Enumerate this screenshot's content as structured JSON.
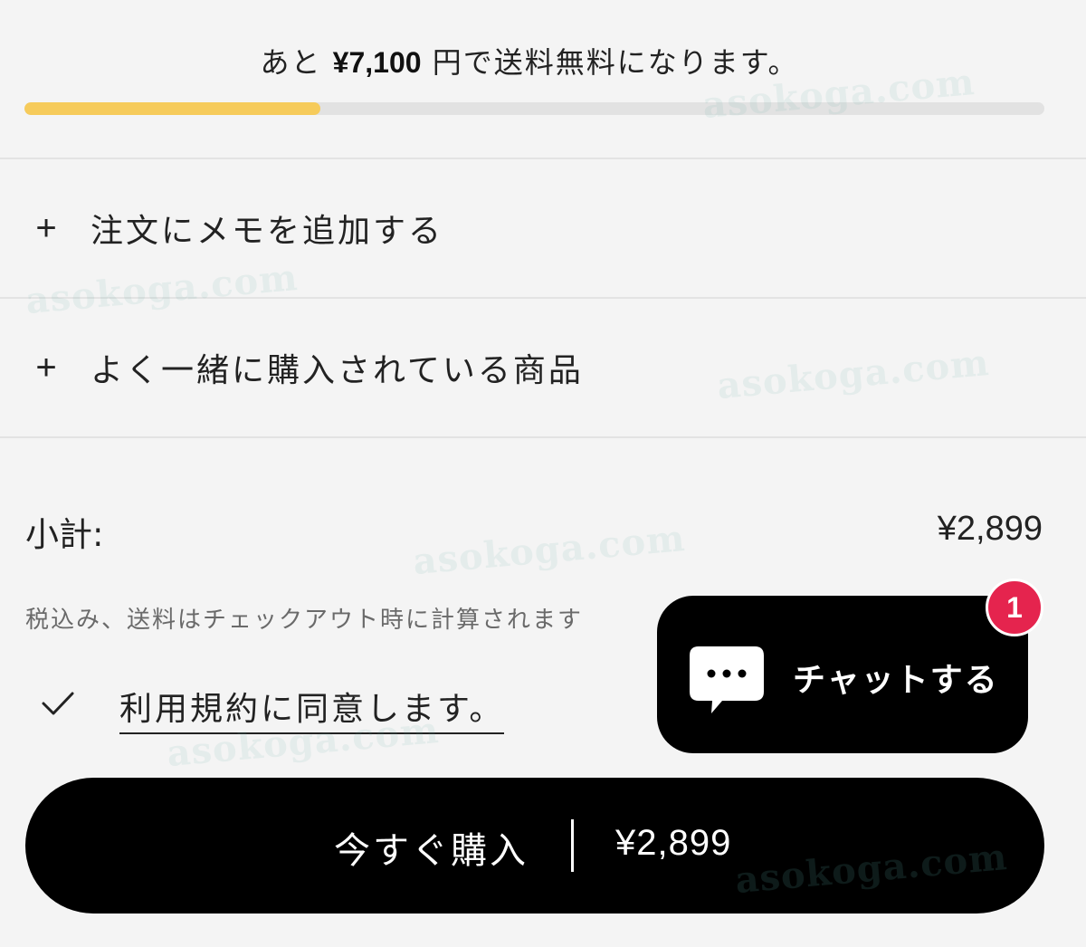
{
  "shipping": {
    "prefix": "あと",
    "amount": "¥7,100",
    "suffix": "円で送料無料になります。",
    "progress_percent": 29
  },
  "accordions": [
    {
      "icon": "plus-icon",
      "label": "注文にメモを追加する"
    },
    {
      "icon": "plus-icon",
      "label": "よく一緒に購入されている商品"
    }
  ],
  "subtotal": {
    "label": "小計:",
    "value": "¥2,899"
  },
  "tax_note": "税込み、送料はチェックアウト時に計算されます",
  "terms": {
    "icon": "checkmark-icon",
    "label": "利用規約に同意します。"
  },
  "chat": {
    "icon": "chat-bubble-icon",
    "label": "チャットする",
    "badge_count": "1"
  },
  "checkout": {
    "label": "今すぐ購入",
    "price": "¥2,899"
  },
  "watermark": "asokoga.com",
  "colors": {
    "progress_fill": "#f6cb5b",
    "progress_track": "#e2e2e2",
    "badge": "#e5244e",
    "button_bg": "#000000",
    "page_bg": "#f4f4f4"
  }
}
